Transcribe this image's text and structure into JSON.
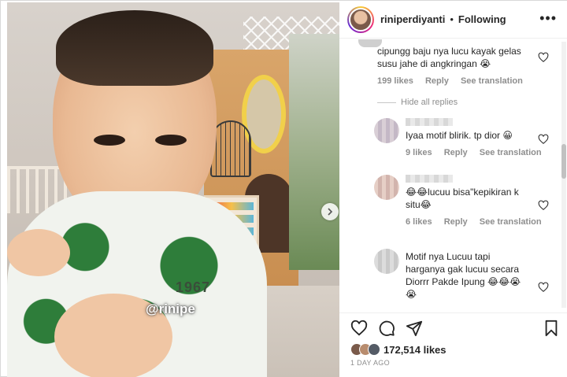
{
  "post": {
    "username": "riniperdiyanti",
    "separator": "•",
    "follow_status": "Following",
    "more_label": "•••"
  },
  "media": {
    "watermark": "@rinipe",
    "shirt_print": "1967",
    "next_icon": "chevron-right-icon"
  },
  "comments": {
    "top": {
      "text": "cipungg baju nya lucu kayak gelas susu jahe di angkringan 😭",
      "likes": "199 likes",
      "reply": "Reply",
      "translate": "See translation"
    },
    "hide_replies": "Hide all replies",
    "replies": [
      {
        "text": "Iyaa motif blirik. tp dior 😀",
        "likes": "9 likes",
        "reply": "Reply",
        "translate": "See translation"
      },
      {
        "text": "😂😂lucuu bisa\"kepikiran k situ😂",
        "likes": "6 likes",
        "reply": "Reply",
        "translate": "See translation"
      },
      {
        "text": "Motif nya Lucuu tapi harganya gak lucuu secara Diorrr Pakde Ipung 😂😂😭 😭",
        "likes": "",
        "reply": "",
        "translate": ""
      }
    ]
  },
  "footer": {
    "likes_count": "172,514 likes",
    "posted": "1 DAY AGO"
  },
  "colors": {
    "text": "#262626",
    "muted": "#8e8e8e",
    "border": "#efefef"
  }
}
